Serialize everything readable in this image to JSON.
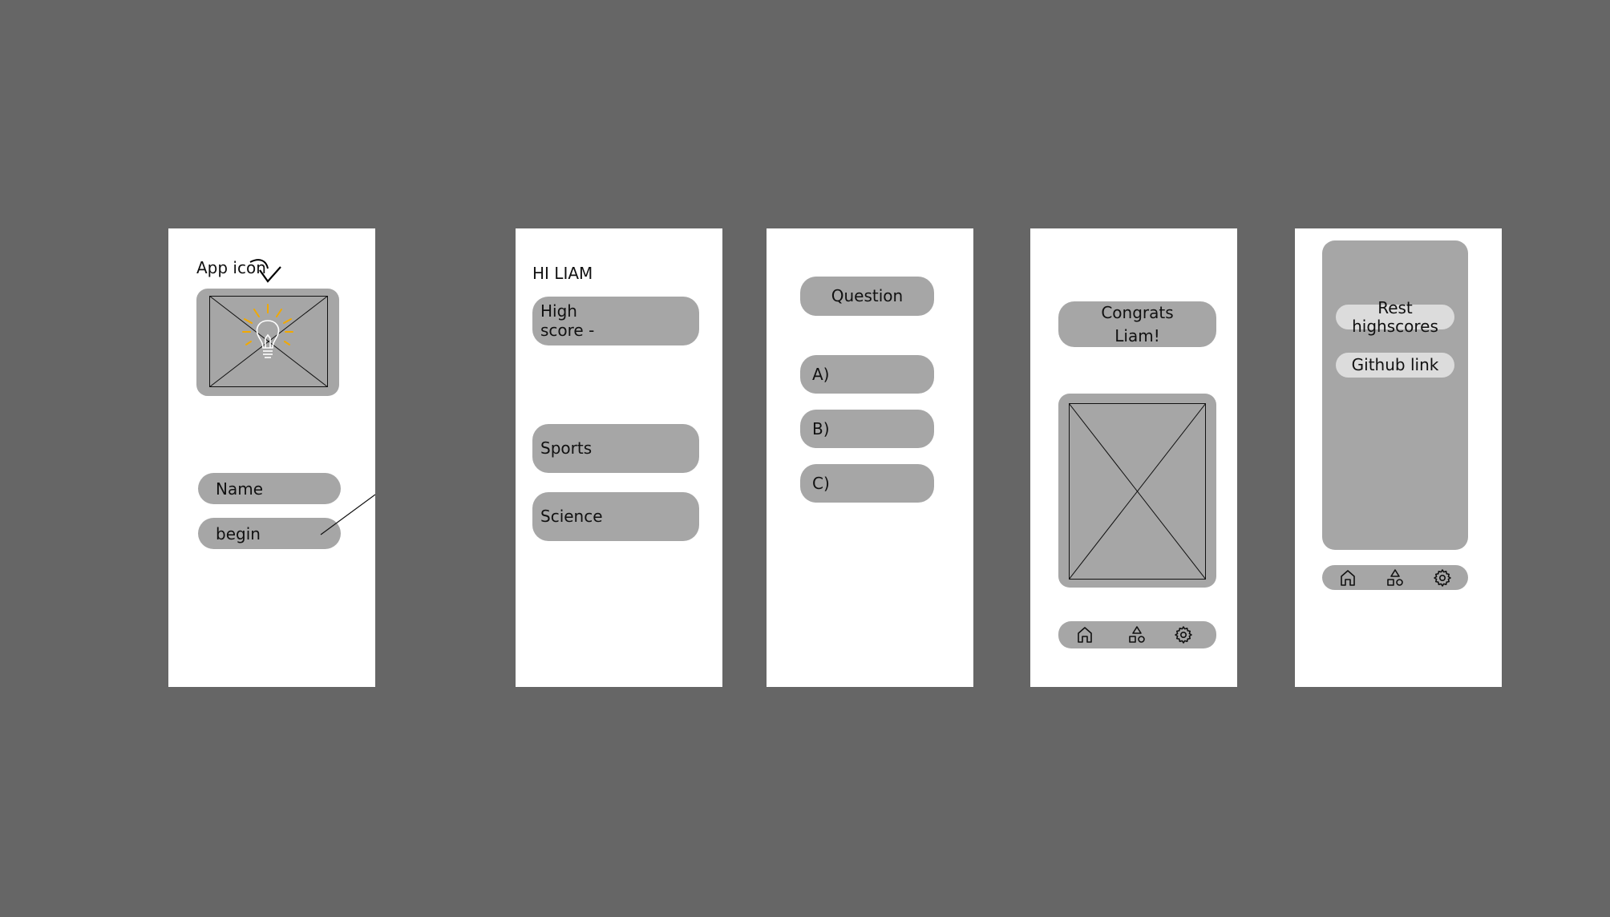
{
  "screen1": {
    "app_icon_label": "App icon",
    "name_field": "Name",
    "begin_button": "begin"
  },
  "screen2": {
    "greeting": "HI LIAM",
    "highscore_line1": "High",
    "highscore_line2": "score -",
    "categories": [
      "Sports",
      "Science"
    ]
  },
  "screen3": {
    "question": "Question",
    "answers": [
      "A)",
      "B)",
      "C)"
    ]
  },
  "screen4": {
    "congrats_line1": "Congrats",
    "congrats_line2": "Liam!",
    "nav": [
      "home-icon",
      "shapes-icon",
      "gear-icon"
    ]
  },
  "screen5": {
    "reset_line1": "Rest",
    "reset_line2": "highscores",
    "github": "Github link",
    "nav": [
      "home-icon",
      "shapes-icon",
      "gear-icon"
    ]
  },
  "colors": {
    "background": "#666666",
    "frame": "#ffffff",
    "element": "#a6a6a6",
    "light_button": "#dcdcdc",
    "bulb_rays": "#f2a900"
  }
}
